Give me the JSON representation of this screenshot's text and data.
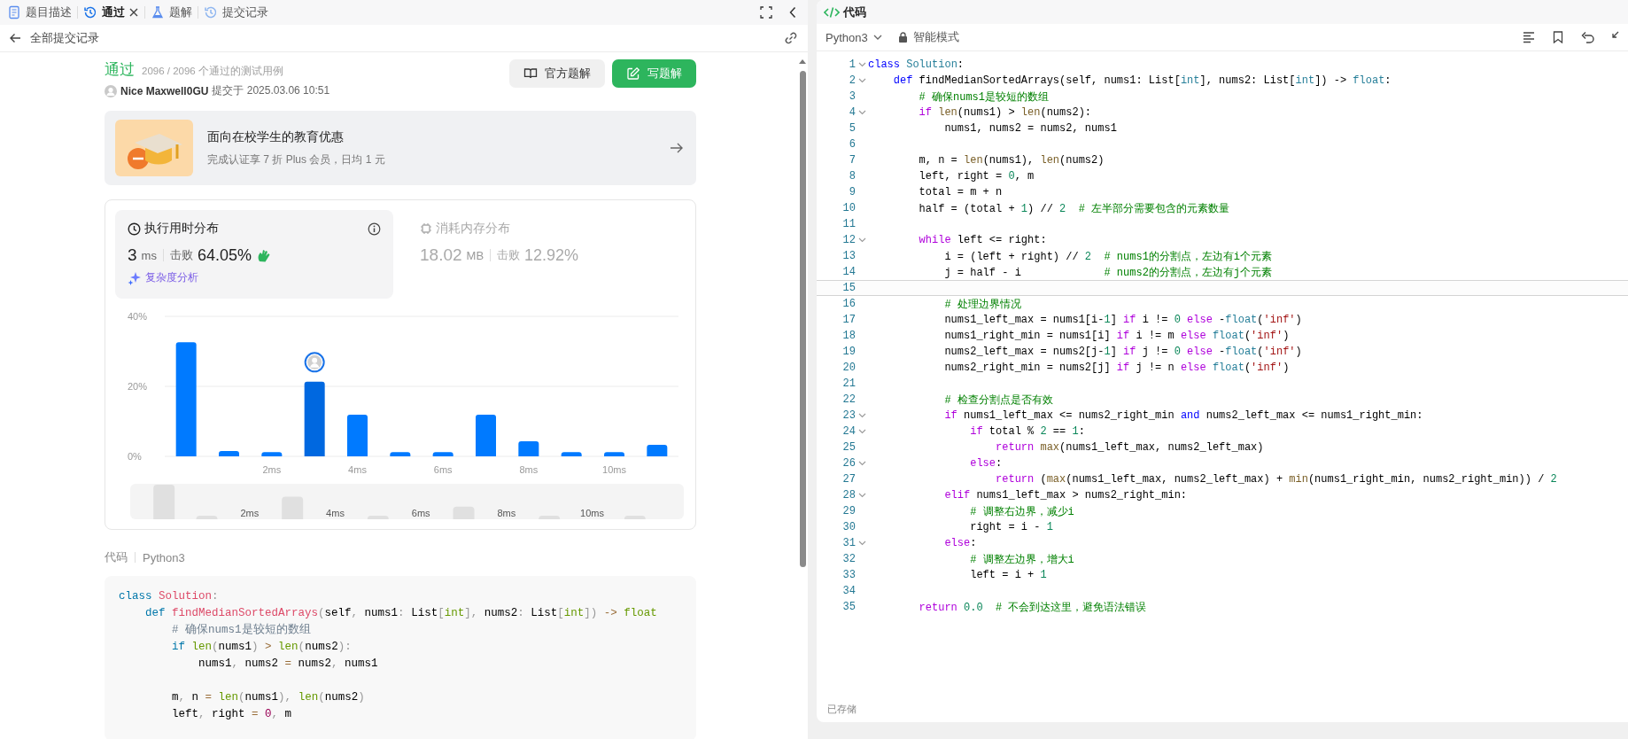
{
  "left_tabs": [
    {
      "label": "题目描述",
      "kind": "description",
      "selected": false,
      "closable": false
    },
    {
      "label": "通过",
      "kind": "result",
      "selected": true,
      "closable": true
    },
    {
      "label": "题解",
      "kind": "solutions",
      "selected": false,
      "closable": false
    },
    {
      "label": "提交记录",
      "kind": "history",
      "selected": false,
      "closable": false
    }
  ],
  "back_label": "全部提交记录",
  "result": {
    "status": "通过",
    "testcases": "2096 / 2096 个通过的测试用例",
    "user": "Nice Maxwell0GU",
    "submitted": "提交于 2025.03.06 10:51"
  },
  "actions": [
    {
      "label": "官方题解",
      "kind": "secondary"
    },
    {
      "label": "写题解",
      "kind": "primary"
    }
  ],
  "promo": {
    "title": "面向在校学生的教育优惠",
    "subtitle": "完成认证享 7 折 Plus 会员，日均 1 元"
  },
  "stats": {
    "distributions": [
      {
        "kind": "time",
        "title": "执行用时分布",
        "selected": true,
        "value": "3",
        "unit": "ms",
        "beat_label": "击败",
        "beat": "64.05%"
      },
      {
        "kind": "memory",
        "title": "消耗内存分布",
        "selected": false,
        "value": "18.02",
        "unit": "MB",
        "beat_label": "击败",
        "beat": "12.92%"
      }
    ],
    "analysis_link": "复杂度分析",
    "chart_data": {
      "type": "bar",
      "x": [
        0,
        1,
        2,
        3,
        4,
        5,
        6,
        7,
        8,
        9,
        10,
        11
      ],
      "series": [
        {
          "color": "#007aff",
          "values": [
            32.6,
            1.5,
            1.2,
            null,
            11.9,
            1.2,
            1.2,
            11.9,
            4.3,
            1.2,
            1.2,
            3.3
          ]
        },
        {
          "color": "#0068e0",
          "values": [
            null,
            null,
            null,
            21.3,
            null,
            null,
            null,
            null,
            null,
            null,
            null,
            null
          ]
        }
      ],
      "xlim": [
        -0.5,
        11.5
      ],
      "ylim": [
        0,
        40
      ],
      "yticks": [
        {
          "value": 0,
          "label": "0%"
        },
        {
          "value": 20,
          "label": "20%"
        },
        {
          "value": 40,
          "label": "40%"
        }
      ],
      "xticks": [
        {
          "value": 2,
          "label": "2ms"
        },
        {
          "value": 4,
          "label": "4ms"
        },
        {
          "value": 6,
          "label": "6ms"
        },
        {
          "value": 8,
          "label": "8ms"
        },
        {
          "value": 10,
          "label": "10ms"
        }
      ]
    },
    "overview_labels": [
      "2ms",
      "4ms",
      "6ms",
      "8ms",
      "10ms"
    ]
  },
  "code_preview": {
    "label": "代码",
    "language": "Python3",
    "lines": [
      {
        "kind": "code",
        "t": [
          {
            "kind": "kw",
            "text": "class"
          },
          {
            "kind": "fn",
            "text": " Solution"
          },
          {
            "kind": "pun",
            "text": ":"
          }
        ]
      },
      {
        "kind": "code",
        "t": [
          {
            "kind": "kw",
            "text": "    def"
          },
          {
            "kind": "fn",
            "text": " findMedianSortedArrays"
          },
          {
            "kind": "pun",
            "text": "("
          },
          {
            "kind": "pl",
            "text": "self"
          },
          {
            "kind": "pun",
            "text": ","
          },
          {
            "kind": "pl",
            "text": " nums1"
          },
          {
            "kind": "pun",
            "text": ":"
          },
          {
            "kind": "pl",
            "text": " List"
          },
          {
            "kind": "pun",
            "text": "["
          },
          {
            "kind": "bi",
            "text": "int"
          },
          {
            "kind": "pun",
            "text": "],"
          },
          {
            "kind": "pl",
            "text": " nums2"
          },
          {
            "kind": "pun",
            "text": ":"
          },
          {
            "kind": "pl",
            "text": " List"
          },
          {
            "kind": "pun",
            "text": "["
          },
          {
            "kind": "bi",
            "text": "int"
          },
          {
            "kind": "pun",
            "text": "])"
          },
          {
            "kind": "op",
            "text": " ->"
          },
          {
            "kind": "bi",
            "text": " float"
          }
        ]
      },
      {
        "kind": "code",
        "t": [
          {
            "kind": "cm",
            "text": "        # 确保nums1是较短的数组"
          }
        ]
      },
      {
        "kind": "code",
        "t": [
          {
            "kind": "kw",
            "text": "        if"
          },
          {
            "kind": "bi",
            "text": " len"
          },
          {
            "kind": "pun",
            "text": "("
          },
          {
            "kind": "pl",
            "text": "nums1"
          },
          {
            "kind": "pun",
            "text": ")"
          },
          {
            "kind": "op",
            "text": " >"
          },
          {
            "kind": "bi",
            "text": " len"
          },
          {
            "kind": "pun",
            "text": "("
          },
          {
            "kind": "pl",
            "text": "nums2"
          },
          {
            "kind": "pun",
            "text": "):"
          }
        ]
      },
      {
        "kind": "code",
        "t": [
          {
            "kind": "pl",
            "text": "            nums1"
          },
          {
            "kind": "pun",
            "text": ","
          },
          {
            "kind": "pl",
            "text": " nums2 "
          },
          {
            "kind": "op",
            "text": "="
          },
          {
            "kind": "pl",
            "text": " nums2"
          },
          {
            "kind": "pun",
            "text": ","
          },
          {
            "kind": "pl",
            "text": " nums1"
          }
        ]
      },
      {
        "kind": "blank"
      },
      {
        "kind": "code",
        "t": [
          {
            "kind": "pl",
            "text": "        m"
          },
          {
            "kind": "pun",
            "text": ","
          },
          {
            "kind": "pl",
            "text": " n "
          },
          {
            "kind": "op",
            "text": "="
          },
          {
            "kind": "bi",
            "text": " len"
          },
          {
            "kind": "pun",
            "text": "("
          },
          {
            "kind": "pl",
            "text": "nums1"
          },
          {
            "kind": "pun",
            "text": "),"
          },
          {
            "kind": "bi",
            "text": " len"
          },
          {
            "kind": "pun",
            "text": "("
          },
          {
            "kind": "pl",
            "text": "nums2"
          },
          {
            "kind": "pun",
            "text": ")"
          }
        ]
      },
      {
        "kind": "code",
        "t": [
          {
            "kind": "pl",
            "text": "        left"
          },
          {
            "kind": "pun",
            "text": ","
          },
          {
            "kind": "pl",
            "text": " right "
          },
          {
            "kind": "op",
            "text": "="
          },
          {
            "kind": "num",
            "text": " 0"
          },
          {
            "kind": "pun",
            "text": ","
          },
          {
            "kind": "pl",
            "text": " m"
          }
        ]
      }
    ]
  },
  "editor": {
    "title": "代码",
    "language": "Python3",
    "mode": "智能模式",
    "status": "已存储",
    "lines": [
      {
        "number": "1",
        "fold": true,
        "current": false,
        "t": [
          {
            "kind": "dk",
            "text": "class"
          },
          {
            "kind": "ty",
            "text": " Solution"
          },
          {
            "kind": "pl",
            "text": ":"
          }
        ]
      },
      {
        "number": "2",
        "fold": true,
        "current": false,
        "t": [
          {
            "kind": "dk",
            "text": "    def"
          },
          {
            "kind": "pl",
            "text": " findMedianSortedArrays(self, nums1: List["
          },
          {
            "kind": "ty",
            "text": "int"
          },
          {
            "kind": "pl",
            "text": "], nums2: List["
          },
          {
            "kind": "ty",
            "text": "int"
          },
          {
            "kind": "pl",
            "text": "]) -> "
          },
          {
            "kind": "ty",
            "text": "float"
          },
          {
            "kind": "pl",
            "text": ":"
          }
        ]
      },
      {
        "number": "3",
        "fold": false,
        "current": false,
        "t": [
          {
            "kind": "cm",
            "text": "        # 确保nums1是较短的数组"
          }
        ]
      },
      {
        "number": "4",
        "fold": true,
        "current": false,
        "t": [
          {
            "kind": "kw",
            "text": "        if"
          },
          {
            "kind": "fn",
            "text": " len"
          },
          {
            "kind": "pl",
            "text": "(nums1) > "
          },
          {
            "kind": "fn",
            "text": "len"
          },
          {
            "kind": "pl",
            "text": "(nums2):"
          }
        ]
      },
      {
        "number": "5",
        "fold": false,
        "current": false,
        "t": [
          {
            "kind": "pl",
            "text": "            nums1, nums2 = nums2, nums1"
          }
        ]
      },
      {
        "number": "6",
        "fold": false,
        "current": false
      },
      {
        "number": "7",
        "fold": false,
        "current": false,
        "t": [
          {
            "kind": "pl",
            "text": "        m, n = "
          },
          {
            "kind": "fn",
            "text": "len"
          },
          {
            "kind": "pl",
            "text": "(nums1), "
          },
          {
            "kind": "fn",
            "text": "len"
          },
          {
            "kind": "pl",
            "text": "(nums2)"
          }
        ]
      },
      {
        "number": "8",
        "fold": false,
        "current": false,
        "t": [
          {
            "kind": "pl",
            "text": "        left, right = "
          },
          {
            "kind": "num",
            "text": "0"
          },
          {
            "kind": "pl",
            "text": ", m"
          }
        ]
      },
      {
        "number": "9",
        "fold": false,
        "current": false,
        "t": [
          {
            "kind": "pl",
            "text": "        total = m + n"
          }
        ]
      },
      {
        "number": "10",
        "fold": false,
        "current": false,
        "t": [
          {
            "kind": "pl",
            "text": "        half = (total + "
          },
          {
            "kind": "num",
            "text": "1"
          },
          {
            "kind": "pl",
            "text": ") // "
          },
          {
            "kind": "num",
            "text": "2"
          },
          {
            "kind": "cm",
            "text": "  # 左半部分需要包含的元素数量"
          }
        ]
      },
      {
        "number": "11",
        "fold": false,
        "current": false
      },
      {
        "number": "12",
        "fold": true,
        "current": false,
        "t": [
          {
            "kind": "kw",
            "text": "        while"
          },
          {
            "kind": "pl",
            "text": " left <= right:"
          }
        ]
      },
      {
        "number": "13",
        "fold": false,
        "current": false,
        "t": [
          {
            "kind": "pl",
            "text": "            i = (left + right) // "
          },
          {
            "kind": "num",
            "text": "2"
          },
          {
            "kind": "cm",
            "text": "  # nums1的分割点，左边有i个元素"
          }
        ]
      },
      {
        "number": "14",
        "fold": false,
        "current": false,
        "t": [
          {
            "kind": "pl",
            "text": "            j = half - i"
          },
          {
            "kind": "cm",
            "text": "             # nums2的分割点，左边有j个元素"
          }
        ]
      },
      {
        "number": "15",
        "fold": false,
        "current": true
      },
      {
        "number": "16",
        "fold": false,
        "current": false,
        "t": [
          {
            "kind": "cm",
            "text": "            # 处理边界情况"
          }
        ]
      },
      {
        "number": "17",
        "fold": false,
        "current": false,
        "t": [
          {
            "kind": "pl",
            "text": "            nums1_left_max = nums1[i-"
          },
          {
            "kind": "num",
            "text": "1"
          },
          {
            "kind": "pl",
            "text": "] "
          },
          {
            "kind": "kw",
            "text": "if"
          },
          {
            "kind": "pl",
            "text": " i != "
          },
          {
            "kind": "num",
            "text": "0"
          },
          {
            "kind": "kw",
            "text": " else"
          },
          {
            "kind": "pl",
            "text": " -"
          },
          {
            "kind": "ty",
            "text": "float"
          },
          {
            "kind": "pl",
            "text": "("
          },
          {
            "kind": "str",
            "text": "'inf'"
          },
          {
            "kind": "pl",
            "text": ")"
          }
        ]
      },
      {
        "number": "18",
        "fold": false,
        "current": false,
        "t": [
          {
            "kind": "pl",
            "text": "            nums1_right_min = nums1[i] "
          },
          {
            "kind": "kw",
            "text": "if"
          },
          {
            "kind": "pl",
            "text": " i != m "
          },
          {
            "kind": "kw",
            "text": "else"
          },
          {
            "kind": "ty",
            "text": " float"
          },
          {
            "kind": "pl",
            "text": "("
          },
          {
            "kind": "str",
            "text": "'inf'"
          },
          {
            "kind": "pl",
            "text": ")"
          }
        ]
      },
      {
        "number": "19",
        "fold": false,
        "current": false,
        "t": [
          {
            "kind": "pl",
            "text": "            nums2_left_max = nums2[j-"
          },
          {
            "kind": "num",
            "text": "1"
          },
          {
            "kind": "pl",
            "text": "] "
          },
          {
            "kind": "kw",
            "text": "if"
          },
          {
            "kind": "pl",
            "text": " j != "
          },
          {
            "kind": "num",
            "text": "0"
          },
          {
            "kind": "kw",
            "text": " else"
          },
          {
            "kind": "pl",
            "text": " -"
          },
          {
            "kind": "ty",
            "text": "float"
          },
          {
            "kind": "pl",
            "text": "("
          },
          {
            "kind": "str",
            "text": "'inf'"
          },
          {
            "kind": "pl",
            "text": ")"
          }
        ]
      },
      {
        "number": "20",
        "fold": false,
        "current": false,
        "t": [
          {
            "kind": "pl",
            "text": "            nums2_right_min = nums2[j] "
          },
          {
            "kind": "kw",
            "text": "if"
          },
          {
            "kind": "pl",
            "text": " j != n "
          },
          {
            "kind": "kw",
            "text": "else"
          },
          {
            "kind": "ty",
            "text": " float"
          },
          {
            "kind": "pl",
            "text": "("
          },
          {
            "kind": "str",
            "text": "'inf'"
          },
          {
            "kind": "pl",
            "text": ")"
          }
        ]
      },
      {
        "number": "21",
        "fold": false,
        "current": false
      },
      {
        "number": "22",
        "fold": false,
        "current": false,
        "t": [
          {
            "kind": "cm",
            "text": "            # 检查分割点是否有效"
          }
        ]
      },
      {
        "number": "23",
        "fold": true,
        "current": false,
        "t": [
          {
            "kind": "kw",
            "text": "            if"
          },
          {
            "kind": "pl",
            "text": " nums1_left_max <= nums2_right_min "
          },
          {
            "kind": "dk",
            "text": "and"
          },
          {
            "kind": "pl",
            "text": " nums2_left_max <= nums1_right_min:"
          }
        ]
      },
      {
        "number": "24",
        "fold": true,
        "current": false,
        "t": [
          {
            "kind": "kw",
            "text": "                if"
          },
          {
            "kind": "pl",
            "text": " total % "
          },
          {
            "kind": "num",
            "text": "2"
          },
          {
            "kind": "pl",
            "text": " == "
          },
          {
            "kind": "num",
            "text": "1"
          },
          {
            "kind": "pl",
            "text": ":"
          }
        ]
      },
      {
        "number": "25",
        "fold": false,
        "current": false,
        "t": [
          {
            "kind": "kw",
            "text": "                    return"
          },
          {
            "kind": "fn",
            "text": " max"
          },
          {
            "kind": "pl",
            "text": "(nums1_left_max, nums2_left_max)"
          }
        ]
      },
      {
        "number": "26",
        "fold": true,
        "current": false,
        "t": [
          {
            "kind": "kw",
            "text": "                else"
          },
          {
            "kind": "pl",
            "text": ":"
          }
        ]
      },
      {
        "number": "27",
        "fold": false,
        "current": false,
        "t": [
          {
            "kind": "kw",
            "text": "                    return"
          },
          {
            "kind": "pl",
            "text": " ("
          },
          {
            "kind": "fn",
            "text": "max"
          },
          {
            "kind": "pl",
            "text": "(nums1_left_max, nums2_left_max) + "
          },
          {
            "kind": "fn",
            "text": "min"
          },
          {
            "kind": "pl",
            "text": "(nums1_right_min, nums2_right_min)) / "
          },
          {
            "kind": "num",
            "text": "2"
          }
        ]
      },
      {
        "number": "28",
        "fold": true,
        "current": false,
        "t": [
          {
            "kind": "kw",
            "text": "            elif"
          },
          {
            "kind": "pl",
            "text": " nums1_left_max > nums2_right_min:"
          }
        ]
      },
      {
        "number": "29",
        "fold": false,
        "current": false,
        "t": [
          {
            "kind": "cm",
            "text": "                # 调整右边界，减少i"
          }
        ]
      },
      {
        "number": "30",
        "fold": false,
        "current": false,
        "t": [
          {
            "kind": "pl",
            "text": "                right = i - "
          },
          {
            "kind": "num",
            "text": "1"
          }
        ]
      },
      {
        "number": "31",
        "fold": true,
        "current": false,
        "t": [
          {
            "kind": "kw",
            "text": "            else"
          },
          {
            "kind": "pl",
            "text": ":"
          }
        ]
      },
      {
        "number": "32",
        "fold": false,
        "current": false,
        "t": [
          {
            "kind": "cm",
            "text": "                # 调整左边界，增大i"
          }
        ]
      },
      {
        "number": "33",
        "fold": false,
        "current": false,
        "t": [
          {
            "kind": "pl",
            "text": "                left = i + "
          },
          {
            "kind": "num",
            "text": "1"
          }
        ]
      },
      {
        "number": "34",
        "fold": false,
        "current": false
      },
      {
        "number": "35",
        "fold": false,
        "current": false,
        "t": [
          {
            "kind": "kw",
            "text": "        return"
          },
          {
            "kind": "num",
            "text": " 0.0"
          },
          {
            "kind": "cm",
            "text": "  # 不会到达这里，避免语法错误"
          }
        ]
      }
    ]
  }
}
